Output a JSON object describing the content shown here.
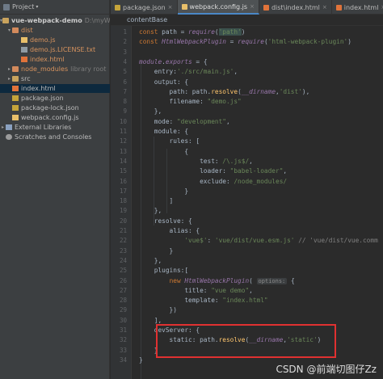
{
  "project_panel": {
    "header_label": "Project",
    "tree": [
      {
        "label": "vue-webpack-demo",
        "extra": "D:\\myWork",
        "kind": "folder"
      },
      {
        "label": "dist",
        "kind": "folder-excluded"
      },
      {
        "label": "demo.js",
        "kind": "js"
      },
      {
        "label": "demo.js.LICENSE.txt",
        "kind": "txt"
      },
      {
        "label": "index.html",
        "kind": "html"
      },
      {
        "label": "node_modules",
        "extra": "library root",
        "kind": "folder-excluded"
      },
      {
        "label": "src",
        "kind": "folder"
      },
      {
        "label": "index.html",
        "kind": "html",
        "selected": true
      },
      {
        "label": "package.json",
        "kind": "json"
      },
      {
        "label": "package-lock.json",
        "kind": "json"
      },
      {
        "label": "webpack.config.js",
        "kind": "js"
      },
      {
        "label": "External Libraries",
        "kind": "lib"
      },
      {
        "label": "Scratches and Consoles",
        "kind": "scratch"
      }
    ]
  },
  "tabs": [
    {
      "label": "package.json",
      "active": false
    },
    {
      "label": "webpack.config.js",
      "active": true
    },
    {
      "label": "dist\\index.html",
      "active": false
    },
    {
      "label": "index.html",
      "active": false
    }
  ],
  "breadcrumb": "contentBase",
  "code": {
    "line_numbers": [
      "1",
      "2",
      "3",
      "4",
      "5",
      "6",
      "7",
      "8",
      "9",
      "10",
      "11",
      "12",
      "13",
      "14",
      "15",
      "16",
      "17",
      "18",
      "19",
      "20",
      "21",
      "22",
      "23",
      "24",
      "25",
      "26",
      "27",
      "28",
      "29",
      "30",
      "31",
      "32",
      "33",
      "34"
    ],
    "inlay_hint": "options:"
  },
  "watermark": "CSDN @前端切图仔Zz",
  "colors": {
    "highlight_border": "#e03131",
    "selected_row": "#0d293e",
    "active_tab_underline": "#4a88c7"
  }
}
